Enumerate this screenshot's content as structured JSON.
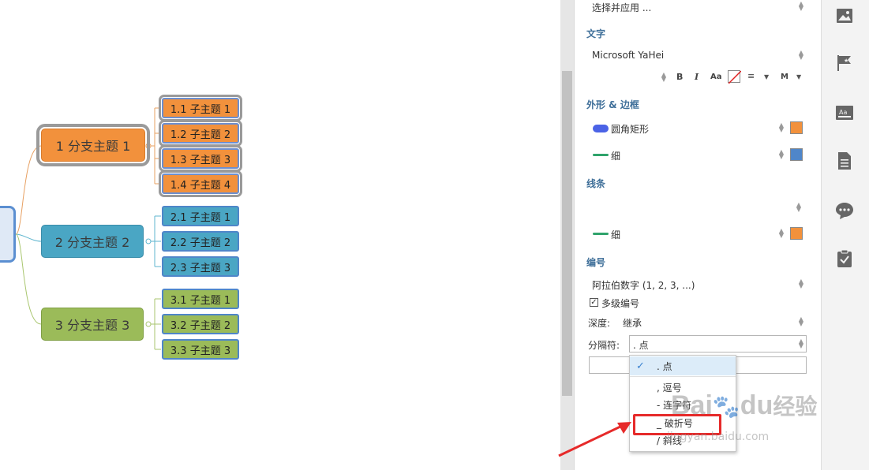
{
  "mindmap": {
    "branches": [
      {
        "label": "1 分支主题 1",
        "color": "#f2913c",
        "subtopics": [
          "1.1 子主题 1",
          "1.2 子主题 2",
          "1.3 子主题 3",
          "1.4 子主题 4"
        ]
      },
      {
        "label": "2 分支主题 2",
        "color": "#4aa6c4",
        "subtopics": [
          "2.1 子主题 1",
          "2.2 子主题 2",
          "2.3 子主题 3"
        ]
      },
      {
        "label": "3 分支主题 3",
        "color": "#9bbb59",
        "subtopics": [
          "3.1 子主题 1",
          "3.2 子主题 2",
          "3.3 子主题 3"
        ]
      }
    ]
  },
  "panel": {
    "top_select": "选择并应用 ...",
    "text_section": "文字",
    "font_name": "Microsoft YaHei",
    "format_buttons": {
      "bold": "B",
      "italic": "I",
      "case": "Aa",
      "align": "≡",
      "size": "M"
    },
    "shape_section": "外形 & 边框",
    "shape_value": "圆角矩形",
    "shape_color": "#f2913c",
    "border_value": "细",
    "border_color": "#4f86c9",
    "line_section": "线条",
    "line_value": "细",
    "line_color": "#f2913c",
    "numbering_section": "编号",
    "numbering_value": "阿拉伯数字 (1, 2, 3, ...)",
    "multilevel_label": "多级编号",
    "multilevel_checked": true,
    "depth_label": "深度:",
    "depth_value": "继承",
    "separator_label": "分隔符:",
    "separator_value": ". 点"
  },
  "dropdown": {
    "items": [
      ". 点",
      ", 逗号",
      "- 连字符",
      "_ 破折号",
      "/ 斜线"
    ],
    "selected": ". 点",
    "highlighted": "_ 破折号",
    "highlight_color": "#e62a2a"
  },
  "watermark": {
    "text1": "Bai",
    "text2": "du",
    "text3": "经验",
    "url": "jingyan.baidu.com"
  },
  "rail": {
    "icons": [
      "image-icon",
      "flag-icon",
      "text-style-icon",
      "document-icon",
      "comment-icon",
      "task-icon"
    ]
  }
}
